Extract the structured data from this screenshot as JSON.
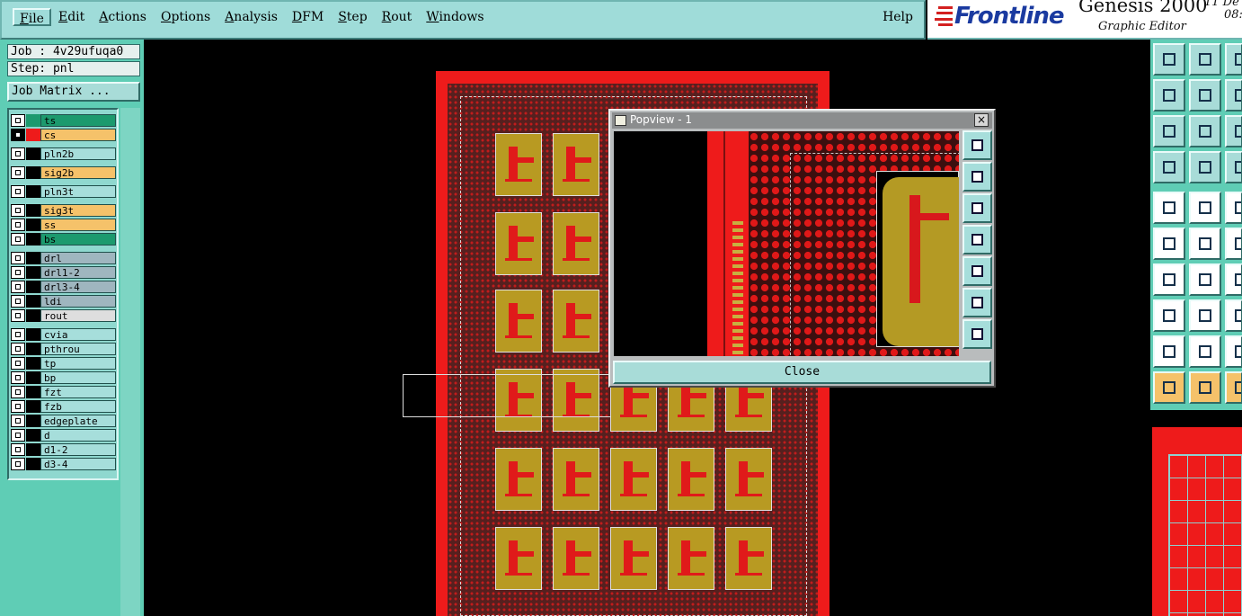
{
  "menubar": {
    "items": [
      "File",
      "Edit",
      "Actions",
      "Options",
      "Analysis",
      "DFM",
      "Step",
      "Rout",
      "Windows"
    ],
    "help": "Help"
  },
  "brand": {
    "logo": "Frontline",
    "product": "Genesis 2000",
    "subtitle": "Graphic Editor",
    "date_line1": "11 De",
    "date_line2": "08:"
  },
  "left": {
    "job": "Job : 4v29ufuqa0",
    "step": "Step: pnl",
    "job_matrix": "Job Matrix ..."
  },
  "layers": [
    {
      "name": "ts",
      "color": "#1c9a6e",
      "swatch": "#1c9a6e",
      "checked": false
    },
    {
      "name": "cs",
      "color": "#f5c26a",
      "swatch": "#ee1b1b",
      "checked": true
    },
    {
      "name": "pln2b",
      "color": "#a6dedb",
      "swatch": "#000000",
      "checked": false
    },
    {
      "name": "sig2b",
      "color": "#f5c26a",
      "swatch": "#000000",
      "checked": false
    },
    {
      "name": "pln3t",
      "color": "#a6dedb",
      "swatch": "#000000",
      "checked": false
    },
    {
      "name": "sig3t",
      "color": "#f5c26a",
      "swatch": "#000000",
      "checked": false
    },
    {
      "name": "ss",
      "color": "#f5c26a",
      "swatch": "#000000",
      "checked": false
    },
    {
      "name": "bs",
      "color": "#1c9a6e",
      "swatch": "#000000",
      "checked": false
    },
    {
      "name": "drl",
      "color": "#9fb6bf",
      "swatch": "#000000",
      "checked": false
    },
    {
      "name": "drl1-2",
      "color": "#9fb6bf",
      "swatch": "#000000",
      "checked": false
    },
    {
      "name": "drl3-4",
      "color": "#9fb6bf",
      "swatch": "#000000",
      "checked": false
    },
    {
      "name": "ldi",
      "color": "#9fb6bf",
      "swatch": "#000000",
      "checked": false
    },
    {
      "name": "rout",
      "color": "#dedede",
      "swatch": "#000000",
      "checked": false
    },
    {
      "name": "cvia",
      "color": "#a6dedb",
      "swatch": "#000000",
      "checked": false
    },
    {
      "name": "pthrou",
      "color": "#a6dedb",
      "swatch": "#000000",
      "checked": false
    },
    {
      "name": "tp",
      "color": "#a6dedb",
      "swatch": "#000000",
      "checked": false
    },
    {
      "name": "bp",
      "color": "#a6dedb",
      "swatch": "#000000",
      "checked": false
    },
    {
      "name": "fzt",
      "color": "#a6dedb",
      "swatch": "#000000",
      "checked": false
    },
    {
      "name": "fzb",
      "color": "#a6dedb",
      "swatch": "#000000",
      "checked": false
    },
    {
      "name": "edgeplate",
      "color": "#a6dedb",
      "swatch": "#000000",
      "checked": false
    },
    {
      "name": "d",
      "color": "#a6dedb",
      "swatch": "#000000",
      "checked": false
    },
    {
      "name": "d1-2",
      "color": "#a6dedb",
      "swatch": "#000000",
      "checked": false
    },
    {
      "name": "d3-4",
      "color": "#a6dedb",
      "swatch": "#000000",
      "checked": false
    }
  ],
  "popview": {
    "title": "Popview - 1",
    "close_label": "Close",
    "close_glyph": "×",
    "tools": [
      "zoom-in-icon",
      "zoom-up-icon",
      "zoom-down-icon",
      "pan-left-icon",
      "pan-right-icon",
      "fit-icon",
      "home-icon"
    ]
  },
  "toolbox": {
    "icons": [
      "pan-up-icon",
      "pan-down-icon",
      "zoom-1-icon",
      "pan-left-icon",
      "pan-right-icon",
      "zoom-2-icon",
      "fit-all-icon",
      "fit-panel-icon",
      "zoom-3-icon",
      "measure-icon",
      "grid-icon",
      "snap-icon",
      "add-pad-icon",
      "add-line-icon",
      "add-text-icon",
      "connect-icon",
      "delete-icon",
      "arc-icon",
      "line-slash-icon",
      "line-blue-icon",
      "rotate-icon",
      "pad-pair-icon",
      "line-minus-icon",
      "align-icon",
      "triangle-icon",
      "triangle-2-icon",
      "triangle-3-icon",
      "select-icon",
      "select-box-icon",
      "no-select-icon"
    ]
  }
}
